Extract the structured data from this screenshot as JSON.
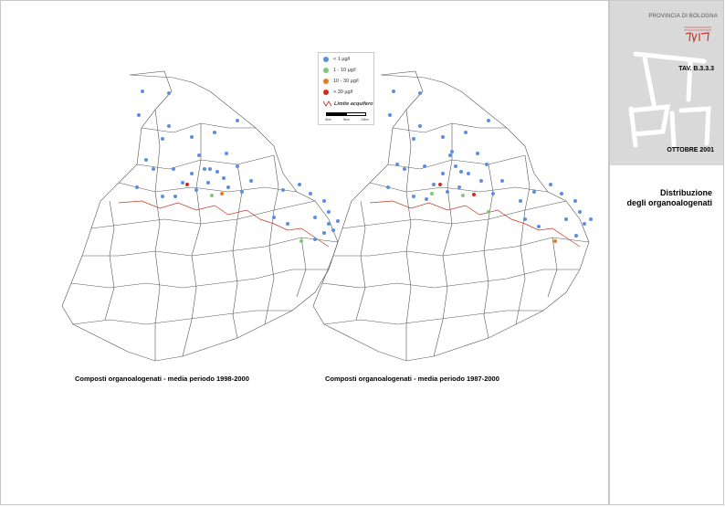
{
  "sidebar": {
    "province": "PROVINCIA DI BOLOGNA",
    "tav": "TAV. B.3.3.3",
    "date": "OTTOBRE 2001",
    "title_line1": "Distribuzione",
    "title_line2": "degli organoalogenati"
  },
  "legend": {
    "items": [
      {
        "label": "< 1 µg/l",
        "color": "#5b8fe0"
      },
      {
        "label": "1 - 10 µg/l",
        "color": "#7fc87a"
      },
      {
        "label": "10 - 30 µg/l",
        "color": "#e57a1e"
      },
      {
        "label": "> 30 µg/l",
        "color": "#d42a1a"
      }
    ],
    "limit_label": "Limite acquifero",
    "limit_color": "#c0392b",
    "scale_labels": [
      "0km",
      "5km",
      "10km"
    ]
  },
  "maps": [
    {
      "caption": "Composti organoalogenati - media periodo 1998-2000"
    },
    {
      "caption": "Composti organoalogenati - media periodo 1987-2000"
    }
  ]
}
